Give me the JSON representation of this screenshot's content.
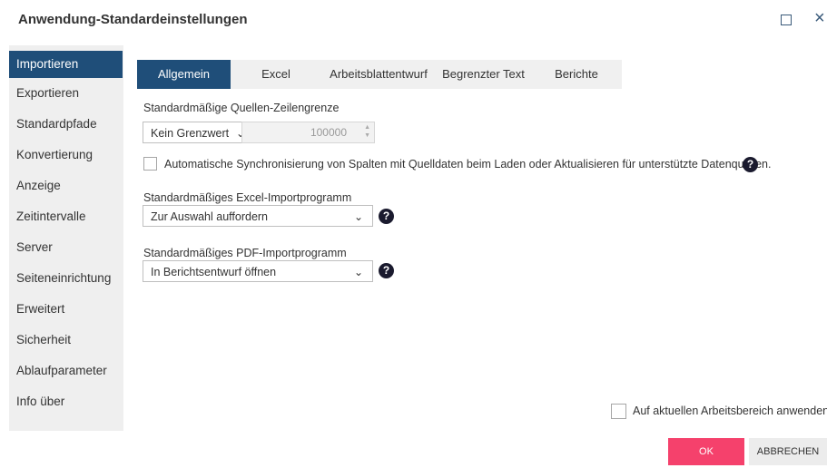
{
  "window": {
    "title": "Anwendung-Standardeinstellungen"
  },
  "sidebar": {
    "items": [
      {
        "label": "Importieren",
        "active": true
      },
      {
        "label": "Exportieren"
      },
      {
        "label": "Standardpfade"
      },
      {
        "label": "Konvertierung"
      },
      {
        "label": "Anzeige"
      },
      {
        "label": "Zeitintervalle"
      },
      {
        "label": "Server"
      },
      {
        "label": "Seiteneinrichtung"
      },
      {
        "label": "Erweitert"
      },
      {
        "label": "Sicherheit"
      },
      {
        "label": "Ablaufparameter"
      },
      {
        "label": "Info über"
      }
    ]
  },
  "tabs": [
    {
      "label": "Allgemein",
      "active": true
    },
    {
      "label": "Excel"
    },
    {
      "label": "Arbeitsblattentwurf"
    },
    {
      "label": "Begrenzter Text"
    },
    {
      "label": "Berichte"
    }
  ],
  "row_limit": {
    "label": "Standardmäßige Quellen-Zeilengrenze",
    "select_value": "Kein Grenzwert",
    "number_value": "100000"
  },
  "auto_sync": {
    "label": "Automatische Synchronisierung von Spalten mit Quelldaten beim Laden oder Aktualisieren für unterstützte Datenquellen.",
    "checked": false
  },
  "excel_import": {
    "label": "Standardmäßiges Excel-Importprogramm",
    "value": "Zur Auswahl auffordern"
  },
  "pdf_import": {
    "label": "Standardmäßiges PDF-Importprogramm",
    "value": "In Berichtsentwurf öffnen"
  },
  "apply_workspace": {
    "label": "Auf aktuellen Arbeitsbereich anwenden",
    "checked": false
  },
  "buttons": {
    "ok": "OK",
    "cancel": "ABBRECHEN"
  },
  "colors": {
    "accent": "#1f4e79",
    "ok_button": "#f5416c"
  }
}
